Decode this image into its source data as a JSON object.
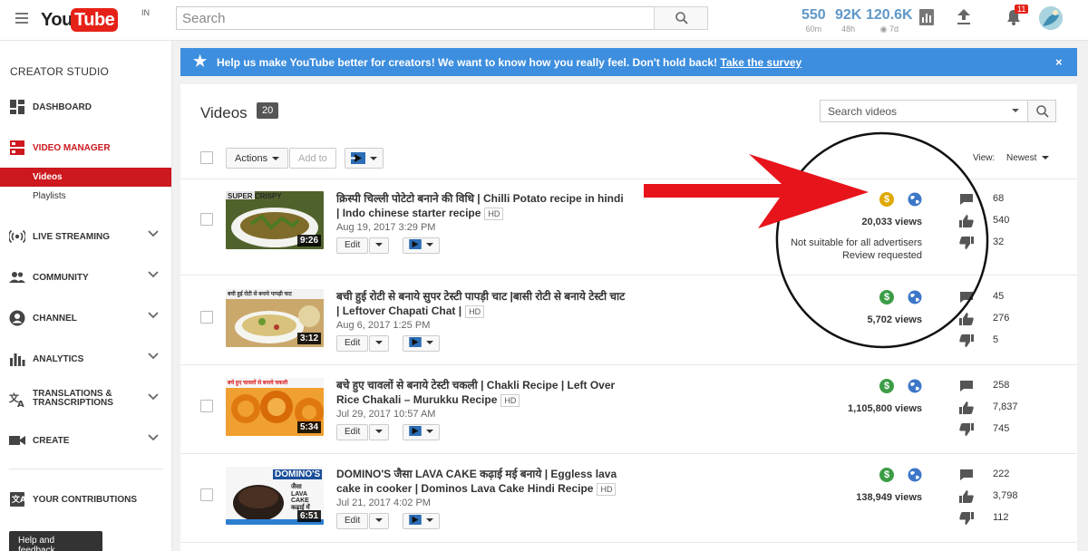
{
  "header": {
    "logo_you": "You",
    "logo_tube": "Tube",
    "logo_region": "IN",
    "search_placeholder": "Search",
    "stats": [
      {
        "value": "550",
        "period": "60m"
      },
      {
        "value": "92K",
        "period": "48h"
      },
      {
        "value": "120.6K",
        "period": "7d"
      }
    ],
    "notification_count": "11"
  },
  "sidebar": {
    "title": "CREATOR STUDIO",
    "items": [
      {
        "label": "DASHBOARD",
        "icon": "dashboard-icon"
      },
      {
        "label": "VIDEO MANAGER",
        "icon": "video-manager-icon"
      },
      {
        "label": "LIVE STREAMING",
        "icon": "live-streaming-icon"
      },
      {
        "label": "COMMUNITY",
        "icon": "community-icon"
      },
      {
        "label": "CHANNEL",
        "icon": "channel-icon"
      },
      {
        "label": "ANALYTICS",
        "icon": "analytics-icon"
      },
      {
        "label": "TRANSLATIONS &",
        "label2": "TRANSCRIPTIONS",
        "icon": "translate-icon"
      },
      {
        "label": "CREATE",
        "icon": "create-icon"
      },
      {
        "label": "YOUR CONTRIBUTIONS",
        "icon": "contributions-icon"
      }
    ],
    "sub_items": [
      "Videos",
      "Playlists"
    ],
    "help": "Help and feedback"
  },
  "banner": {
    "text": "Help us make YouTube better for creators! We want to know how you really feel. Don't hold back!",
    "link": "Take the survey",
    "close": "×"
  },
  "main": {
    "title": "Videos",
    "count": "20",
    "search_placeholder": "Search videos",
    "actions_label": "Actions",
    "add_to_label": "Add to",
    "view_label": "View:",
    "view_value": "Newest",
    "edit_label": "Edit"
  },
  "videos": [
    {
      "title": "क्रिस्पी चिल्ली पोटेटो बनाने की विधि | Chilli Potato recipe in hindi | Indo chinese starter recipe",
      "badge": "HD",
      "date": "Aug 19, 2017 3:29 PM",
      "duration": "9:26",
      "thumb_text": "SUPER CRISPY",
      "views": "20,033 views",
      "warning1": "Not suitable for all advertisers",
      "warning2": "Review requested",
      "comments": "68",
      "likes": "540",
      "dislikes": "32",
      "monetization_color": "#e0a800",
      "thumb_color": "#6b7a3c"
    },
    {
      "title": "बची हुई रोटी से बनाये सुपर टेस्टी पापड़ी चाट |बासी रोटी से बनाये टेस्टी चाट | Leftover Chapati Chat |",
      "badge": "HD",
      "date": "Aug 6, 2017 1:25 PM",
      "duration": "3:12",
      "thumb_text": "बची हुई रोटी से बनाये पापड़ी चाट",
      "views": "5,702 views",
      "comments": "45",
      "likes": "276",
      "dislikes": "5",
      "monetization_color": "#3c9c46",
      "thumb_color": "#c9b07a"
    },
    {
      "title": "बचे हुए चावलों से बनाये टेस्टी चकली | Chakli Recipe | Left Over Rice Chakali – Murukku Recipe",
      "badge": "HD",
      "date": "Jul 29, 2017 10:57 AM",
      "duration": "5:34",
      "thumb_text": "बचे हुए चावलों से बनाये चकली",
      "views": "1,105,800 views",
      "comments": "258",
      "likes": "7,837",
      "dislikes": "745",
      "monetization_color": "#3c9c46",
      "thumb_color": "#e48a1e"
    },
    {
      "title": "DOMINO'S जैसा LAVA CAKE कढ़ाई मई बनाये | Eggless lava cake in cooker | Dominos Lava Cake Hindi Recipe",
      "badge": "HD",
      "date": "Jul 21, 2017 4:02 PM",
      "duration": "6:51",
      "thumb_text": "DOMINO'S",
      "thumb_text2": "जैसा LAVA CAKE कढ़ाई में",
      "views": "138,949 views",
      "comments": "222",
      "likes": "3,798",
      "dislikes": "112",
      "monetization_color": "#3c9c46",
      "thumb_color": "#f4f4f4"
    }
  ],
  "colors": {
    "accent_red": "#cc181e",
    "banner_blue": "#3d8ede",
    "stat_blue": "#5f98c9",
    "annotation_red": "#e8141c"
  }
}
